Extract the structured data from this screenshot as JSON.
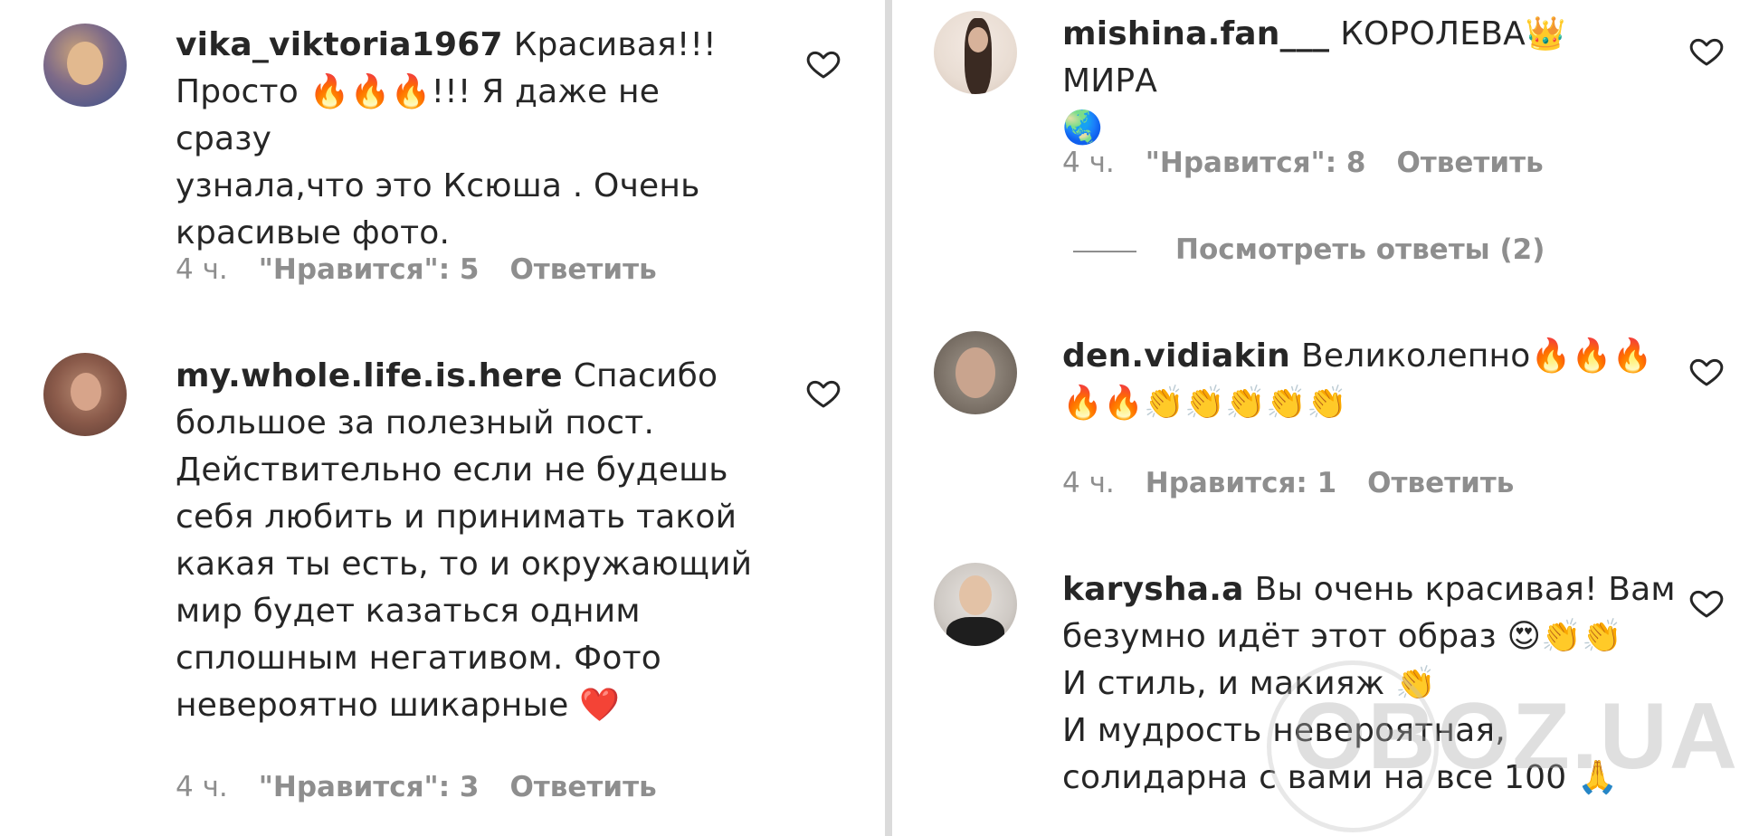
{
  "left": {
    "comments": [
      {
        "username": "vika_viktoria1967",
        "lines": [
          "Красивая!!!",
          "Просто 🔥🔥🔥!!! Я даже не сразу",
          "узнала,что это Ксюша . Очень",
          "красивые фото."
        ],
        "time": "4 ч.",
        "likes": "\"Нравится\": 5",
        "reply": "Ответить"
      },
      {
        "username": "my.whole.life.is.here",
        "lines": [
          "Спасибо",
          "большое за полезный пост.",
          "Действительно если не будешь",
          "себя любить и принимать такой",
          "какая ты есть, то и окружающий",
          "мир будет казаться одним",
          "сплошным негативом. Фото",
          "невероятно шикарные ❤️"
        ],
        "time": "4 ч.",
        "likes": "\"Нравится\": 3",
        "reply": "Ответить"
      }
    ]
  },
  "right": {
    "comments": [
      {
        "username": "mishina.fan___",
        "lines": [
          "КОРОЛЕВА👑МИРА",
          "🌏"
        ],
        "time": "4 ч.",
        "likes": "\"Нравится\": 8",
        "reply": "Ответить",
        "view_replies": "Посмотреть ответы (2)"
      },
      {
        "username": "den.vidiakin",
        "lines": [
          "Великолепно🔥🔥🔥",
          "🔥🔥👏👏👏👏👏"
        ],
        "time": "4 ч.",
        "likes": "Нравится: 1",
        "reply": "Ответить"
      },
      {
        "username": "karysha.a",
        "lines": [
          "Вы очень красивая! Вам",
          "безумно идёт этот образ 😍👏👏",
          "И стиль, и макияж 👏",
          "И мудрость невероятная,",
          "солидарна с вами на все 100 🙏"
        ]
      }
    ]
  },
  "watermark": "OBOZ.UA",
  "icons": {
    "like": "heart-outline-icon"
  }
}
